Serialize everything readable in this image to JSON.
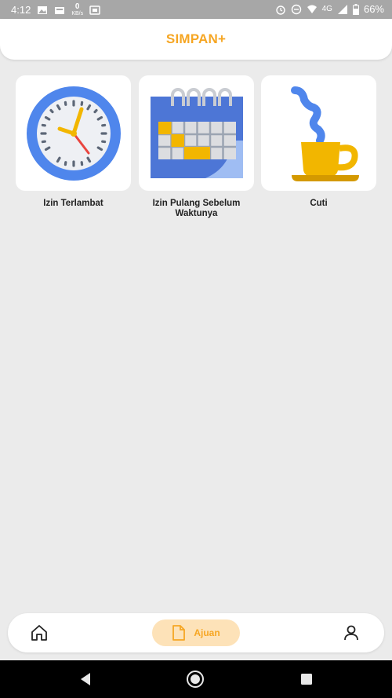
{
  "status_bar": {
    "time": "4:12",
    "kbs_value": "0",
    "kbs_unit": "KB/s",
    "network": "4G",
    "battery": "66%"
  },
  "header": {
    "title": "SIMPAN+"
  },
  "menu": {
    "items": [
      {
        "label": "Izin Terlambat",
        "icon": "clock-icon"
      },
      {
        "label": "Izin Pulang Sebelum Waktunya",
        "icon": "calendar-icon"
      },
      {
        "label": "Cuti",
        "icon": "coffee-cup-icon"
      }
    ]
  },
  "bottom_nav": {
    "home_icon": "home-icon",
    "active_label": "Ajuan",
    "active_icon": "document-icon",
    "profile_icon": "user-icon"
  },
  "colors": {
    "accent": "#f6a623",
    "accent_light": "#fde2b8",
    "background": "#ebebeb",
    "status_bar": "#a7a7a7"
  }
}
